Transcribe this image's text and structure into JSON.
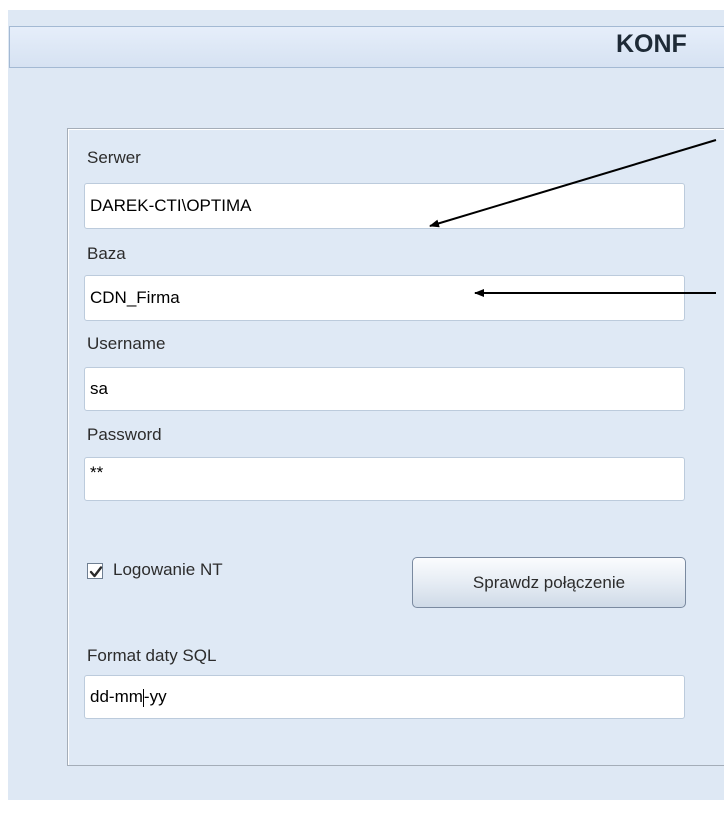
{
  "header": {
    "title": "KONF"
  },
  "form": {
    "server_label": "Serwer",
    "server_value": "DAREK-CTI\\OPTIMA",
    "database_label": "Baza",
    "database_value": "CDN_Firma",
    "username_label": "Username",
    "username_value": "sa",
    "password_label": "Password",
    "password_value": "**",
    "nt_login_label": "Logowanie NT",
    "nt_login_checked": true,
    "test_connection_label": "Sprawdz połączenie",
    "date_format_label": "Format daty SQL",
    "date_format_value_before_caret": "dd-mm",
    "date_format_value_after_caret": "-yy"
  },
  "colors": {
    "panel_background": "#dee8f4",
    "header_background": "#d6e2f2",
    "field_border": "#bccbdc",
    "annotation_arrow": "#000000"
  }
}
